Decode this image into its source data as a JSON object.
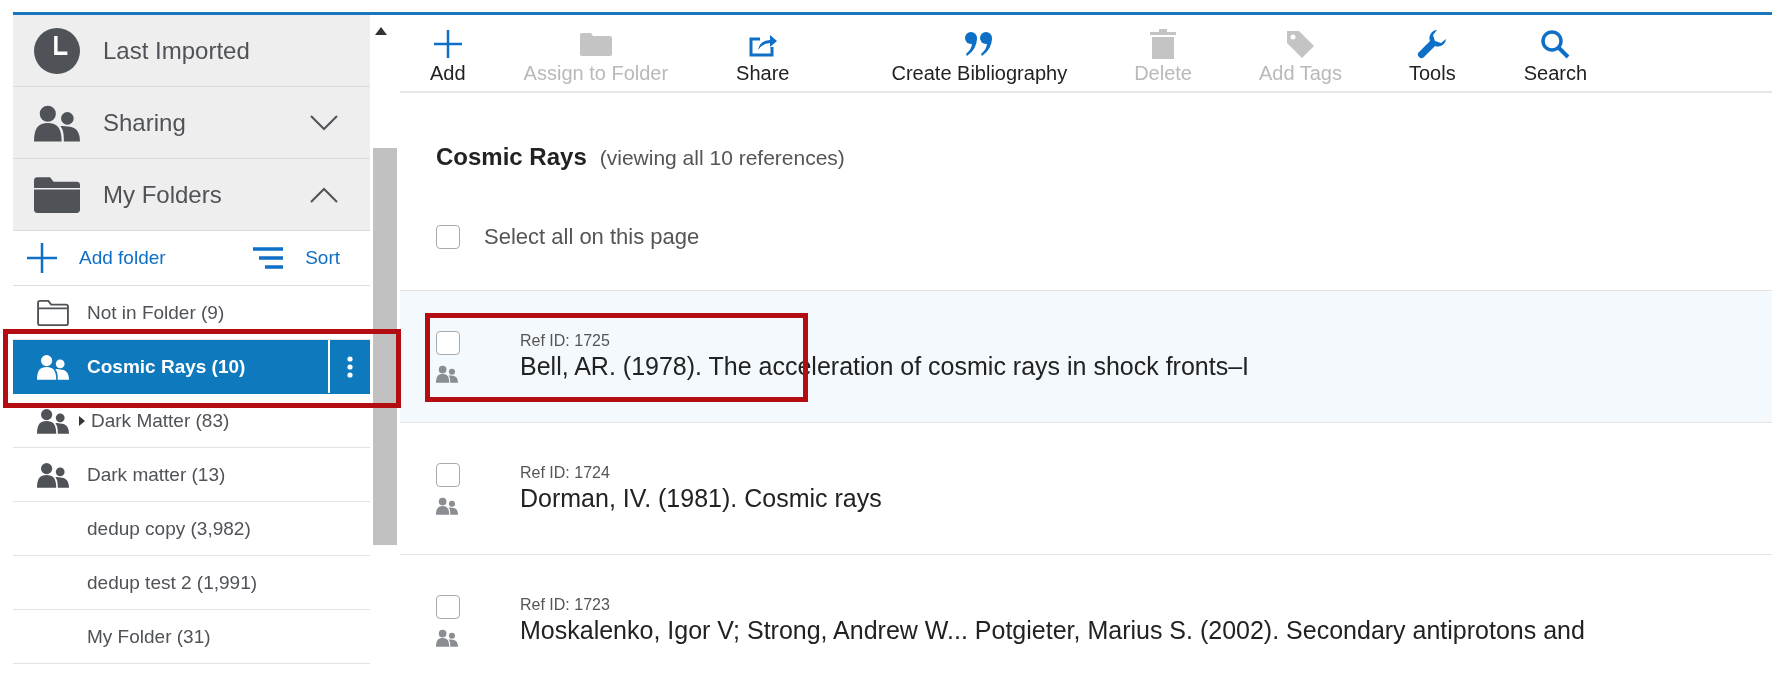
{
  "sidebar": {
    "sections": [
      {
        "kind": "recent",
        "label": "Last Imported"
      },
      {
        "kind": "shared",
        "label": "Sharing",
        "expanded": false
      },
      {
        "kind": "folders",
        "label": "My Folders",
        "expanded": true
      }
    ],
    "folder_actions": [
      {
        "kind": "add",
        "label": "Add folder"
      },
      {
        "kind": "sort",
        "label": "Sort"
      }
    ],
    "folders": [
      {
        "kind": "plain",
        "label": "Not in Folder (9)",
        "selected": false
      },
      {
        "kind": "shared",
        "label": "Cosmic Rays (10)",
        "selected": true,
        "annotated": true
      },
      {
        "kind": "shared",
        "label": "Dark Matter (83)",
        "selected": false,
        "has_children": true
      },
      {
        "kind": "shared",
        "label": "Dark matter (13)",
        "selected": false
      },
      {
        "kind": "none",
        "label": "dedup copy (3,982)",
        "selected": false
      },
      {
        "kind": "none",
        "label": "dedup test 2 (1,991)",
        "selected": false
      },
      {
        "kind": "none",
        "label": "My Folder (31)",
        "selected": false
      }
    ]
  },
  "toolbar": [
    {
      "kind": "add",
      "label": "Add",
      "disabled": false
    },
    {
      "kind": "folder",
      "label": "Assign to Folder",
      "disabled": true
    },
    {
      "kind": "share",
      "label": "Share",
      "disabled": false
    },
    {
      "kind": "quote",
      "label": "Create Bibliography",
      "disabled": false
    },
    {
      "kind": "trash",
      "label": "Delete",
      "disabled": true
    },
    {
      "kind": "tag",
      "label": "Add Tags",
      "disabled": true
    },
    {
      "kind": "wrench",
      "label": "Tools",
      "disabled": false
    },
    {
      "kind": "search",
      "label": "Search",
      "disabled": false
    }
  ],
  "heading": {
    "title": "Cosmic Rays",
    "subtitle": "(viewing all 10 references)"
  },
  "select_all": {
    "label": "Select all on this page",
    "checked": false
  },
  "references": [
    {
      "ref_id": "Ref ID: 1725",
      "title": "Bell, AR. (1978). The acceleration of cosmic rays in shock fronts–I",
      "checked": false,
      "shared": true,
      "hovered": true,
      "annotated": true
    },
    {
      "ref_id": "Ref ID: 1724",
      "title": "Dorman, IV. (1981). Cosmic rays",
      "checked": false,
      "shared": true,
      "hovered": false
    },
    {
      "ref_id": "Ref ID: 1723",
      "title": "Moskalenko, Igor V; Strong, Andrew W... Potgieter, Marius S. (2002). Secondary antiprotons and",
      "checked": false,
      "shared": true,
      "hovered": false
    }
  ]
}
